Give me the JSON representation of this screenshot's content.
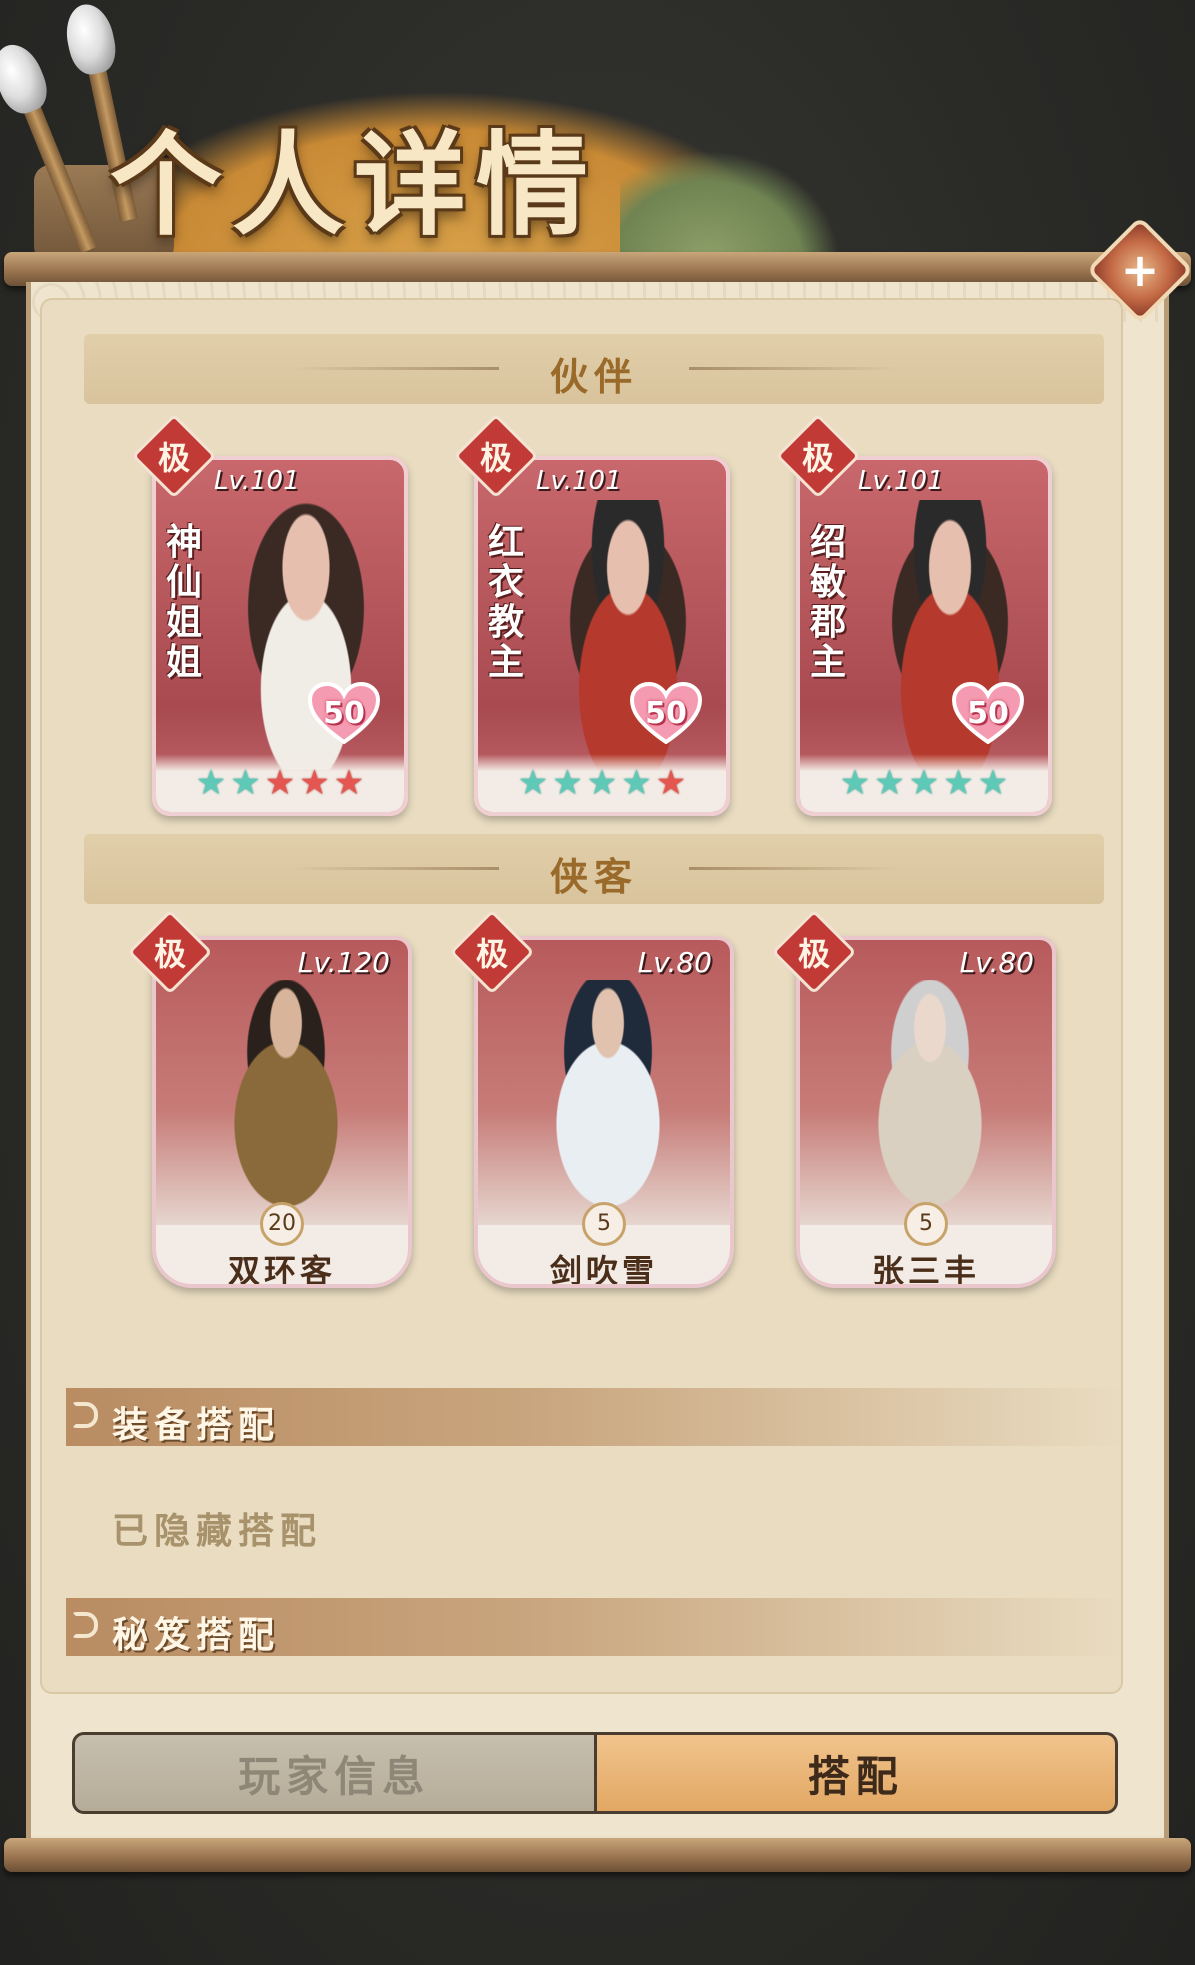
{
  "header": {
    "title": "个人详情",
    "close_label": "+"
  },
  "partners_section": {
    "title": "伙伴",
    "cards": [
      {
        "rank": "极",
        "level": "Lv.101",
        "name": "神\n仙\n姐\n姐",
        "affection": "50",
        "stars": [
          "teal",
          "teal",
          "red",
          "red",
          "red"
        ]
      },
      {
        "rank": "极",
        "level": "Lv.101",
        "name": "红\n衣\n教\n主",
        "affection": "50",
        "stars": [
          "teal",
          "teal",
          "teal",
          "teal",
          "red"
        ]
      },
      {
        "rank": "极",
        "level": "Lv.101",
        "name": "绍\n敏\n郡\n主",
        "affection": "50",
        "stars": [
          "teal",
          "teal",
          "teal",
          "teal",
          "teal"
        ]
      }
    ]
  },
  "heroes_section": {
    "title": "侠客",
    "cards": [
      {
        "rank": "极",
        "level": "Lv.120",
        "badge": "20",
        "name": "双环客"
      },
      {
        "rank": "极",
        "level": "Lv.80",
        "badge": "5",
        "name": "剑吹雪"
      },
      {
        "rank": "极",
        "level": "Lv.80",
        "badge": "5",
        "name": "张三丰"
      }
    ]
  },
  "equipment": {
    "title": "装备搭配",
    "hidden_text": "已隐藏搭配"
  },
  "manual": {
    "title": "秘笈搭配"
  },
  "tabs": {
    "player_info": "玩家信息",
    "loadout": "搭配",
    "active": "搭配"
  },
  "icons": [
    "brush-icon",
    "close-icon",
    "heart-icon",
    "star-icon",
    "scroll-icon"
  ],
  "colors": {
    "accent": "#e2a763",
    "rank_red": "#c23a36",
    "star_teal": "#5ec9b6",
    "star_red": "#e4564f"
  }
}
